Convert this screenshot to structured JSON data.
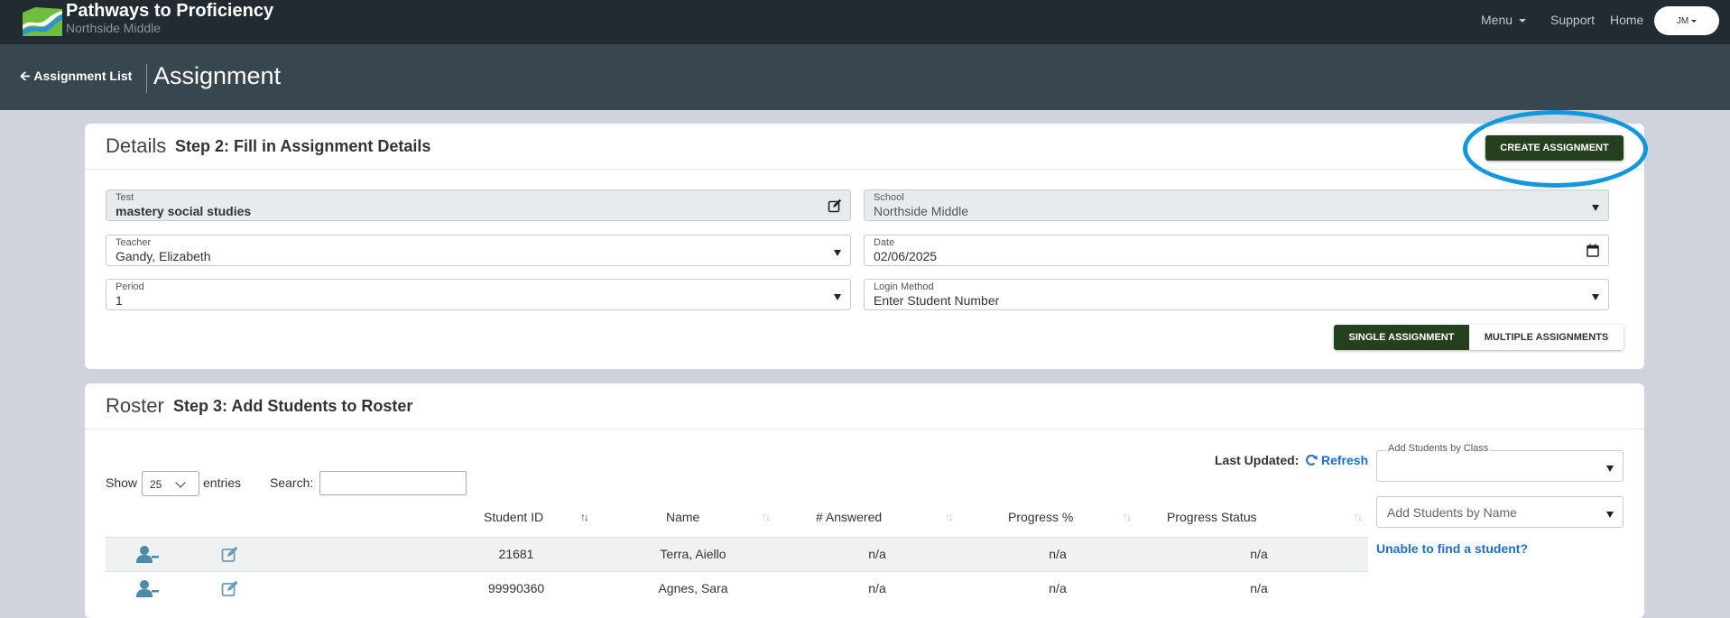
{
  "brand": {
    "title": "Pathways to Proficiency",
    "subtitle": "Northside Middle"
  },
  "nav": {
    "menu": "Menu",
    "support": "Support",
    "home": "Home",
    "user_initials": "JM"
  },
  "header": {
    "back": "Assignment List",
    "title": "Assignment"
  },
  "details": {
    "title": "Details",
    "step": "Step 2: Fill in Assignment Details",
    "create_button": "CREATE ASSIGNMENT",
    "fields": {
      "test": {
        "label": "Test",
        "value": "mastery social studies"
      },
      "school": {
        "label": "School",
        "value": "Northside Middle"
      },
      "teacher": {
        "label": "Teacher",
        "value": "Gandy, Elizabeth"
      },
      "date": {
        "label": "Date",
        "value": "02/06/2025"
      },
      "period": {
        "label": "Period",
        "value": "1"
      },
      "login_method": {
        "label": "Login Method",
        "value": "Enter Student Number"
      }
    },
    "toggle": {
      "single": "SINGLE ASSIGNMENT",
      "multiple": "MULTIPLE ASSIGNMENTS"
    }
  },
  "roster": {
    "title": "Roster",
    "step": "Step 3: Add Students to Roster",
    "last_updated_label": "Last Updated:",
    "refresh": "Refresh",
    "show_label": "Show",
    "entries_value": "25",
    "entries_label": "entries",
    "search_label": "Search:",
    "columns": [
      "Student ID",
      "Name",
      "# Answered",
      "Progress %",
      "Progress Status"
    ],
    "rows": [
      {
        "id": "21681",
        "name": "Terra, Aiello",
        "answered": "n/a",
        "percent": "n/a",
        "status": "n/a"
      },
      {
        "id": "99990360",
        "name": "Agnes, Sara",
        "answered": "n/a",
        "percent": "n/a",
        "status": "n/a"
      }
    ],
    "add_by_class_label": "Add Students by Class",
    "add_by_name_placeholder": "Add Students by Name",
    "unable_link": "Unable to find a student?"
  },
  "colors": {
    "nav_bg": "#212b31",
    "header_bg": "#38464f",
    "primary_button": "#25401e",
    "highlight_ring": "#1197dd",
    "link": "#1a6fd1"
  }
}
